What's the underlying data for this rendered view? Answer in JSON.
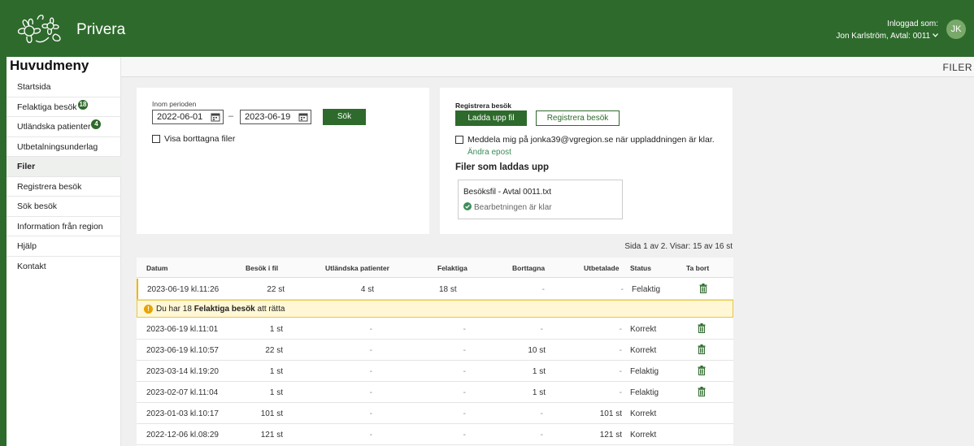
{
  "header": {
    "brand": "Privera",
    "logged_in_label": "Inloggad som:",
    "user_line": "Jon Karlström, Avtal: 0011",
    "avatar_initials": "JK",
    "color": "#2e6a2c"
  },
  "sidebar": {
    "title": "Huvudmeny",
    "items": [
      {
        "label": "Startsida",
        "badge": ""
      },
      {
        "label": "Felaktiga besök",
        "badge": "18"
      },
      {
        "label": "Utländska patienter",
        "badge": "4"
      },
      {
        "label": "Utbetalningsunderlag",
        "badge": ""
      },
      {
        "label": "Filer",
        "badge": "",
        "active": true
      },
      {
        "label": "Registrera besök",
        "badge": ""
      },
      {
        "label": "Sök besök",
        "badge": ""
      },
      {
        "label": "Information från region",
        "badge": ""
      },
      {
        "label": "Hjälp",
        "badge": ""
      },
      {
        "label": "Kontakt",
        "badge": ""
      }
    ]
  },
  "breadcrumb": "FILER",
  "period": {
    "label": "Inom perioden",
    "from": "2022-06-01",
    "dash": "–",
    "to": "2023-06-19",
    "search_button": "Sök",
    "show_deleted_label": "Visa borttagna filer"
  },
  "register": {
    "title": "Registrera besök",
    "upload_button": "Ladda upp fil",
    "register_button": "Registrera besök",
    "notify_label": "Meddela mig på jonka39@vgregion.se när uppladdningen är klar.",
    "change_email": "Ändra epost",
    "uploading_title": "Filer som laddas upp",
    "upload_file": "Besöksfil - Avtal 0011.txt",
    "upload_status": "Bearbetningen är klar"
  },
  "page_info": "Sida 1 av 2. Visar: 15 av 16 st",
  "table": {
    "headers": [
      "Datum",
      "Besök i fil",
      "Utländska patienter",
      "Felaktiga",
      "Borttagna",
      "Utbetalade",
      "Status",
      "Ta bort"
    ],
    "rows": [
      {
        "datum": "2023-06-19 kl.11:26",
        "besok": "22 st",
        "utl": "4 st",
        "fel": "18 st",
        "bort": "-",
        "utb": "-",
        "status": "Felaktig",
        "trash": true
      },
      {
        "datum": "2023-06-19 kl.11:01",
        "besok": "1 st",
        "utl": "-",
        "fel": "-",
        "bort": "-",
        "utb": "-",
        "status": "Korrekt",
        "trash": true
      },
      {
        "datum": "2023-06-19 kl.10:57",
        "besok": "22 st",
        "utl": "-",
        "fel": "-",
        "bort": "10 st",
        "utb": "-",
        "status": "Korrekt",
        "trash": true
      },
      {
        "datum": "2023-03-14 kl.19:20",
        "besok": "1 st",
        "utl": "-",
        "fel": "-",
        "bort": "1 st",
        "utb": "-",
        "status": "Felaktig",
        "trash": true
      },
      {
        "datum": "2023-02-07 kl.11:04",
        "besok": "1 st",
        "utl": "-",
        "fel": "-",
        "bort": "1 st",
        "utb": "-",
        "status": "Felaktig",
        "trash": true
      },
      {
        "datum": "2023-01-03 kl.10:17",
        "besok": "101 st",
        "utl": "-",
        "fel": "-",
        "bort": "-",
        "utb": "101 st",
        "status": "Korrekt",
        "trash": false
      },
      {
        "datum": "2022-12-06 kl.08:29",
        "besok": "121 st",
        "utl": "-",
        "fel": "-",
        "bort": "-",
        "utb": "121 st",
        "status": "Korrekt",
        "trash": false
      }
    ],
    "warning": {
      "pre": "Du har 18 ",
      "bold": "Felaktiga besök",
      "post": " att rätta"
    }
  }
}
